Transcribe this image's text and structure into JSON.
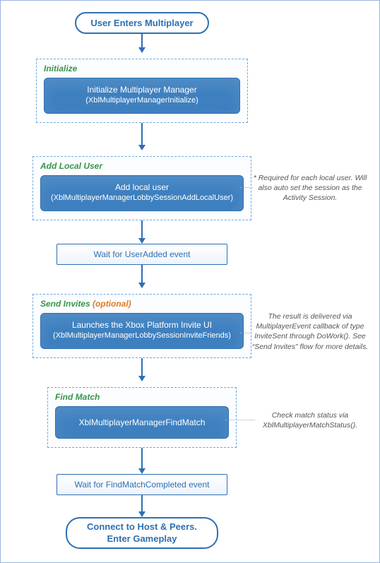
{
  "chart_data": {
    "type": "flowchart",
    "title": "",
    "nodes": [
      {
        "id": "start",
        "kind": "terminal",
        "label": "User Enters Multiplayer"
      },
      {
        "id": "init",
        "kind": "action",
        "group": "Initialize",
        "label": "Initialize Multiplayer Manager",
        "api": "(XblMultiplayerManagerInitialize)"
      },
      {
        "id": "addlocal",
        "kind": "action",
        "group": "Add Local User",
        "label": "Add local user",
        "api": "(XblMultiplayerManagerLobbySessionAddLocalUser)",
        "note": "* Required for each local user. Will also auto set the session as the Activity Session."
      },
      {
        "id": "wait1",
        "kind": "wait",
        "label": "Wait for UserAdded event"
      },
      {
        "id": "invite",
        "kind": "action",
        "group": "Send Invites",
        "group_suffix": "(optional)",
        "label": "Launches the Xbox Platform Invite UI",
        "api": "(XblMultiplayerManagerLobbySessionInviteFriends)",
        "note": "The result is delivered via MultiplayerEvent callback of type InviteSent through DoWork(). See \"Send Invites\" flow  for more details."
      },
      {
        "id": "find",
        "kind": "action",
        "group": "Find Match",
        "label": "XblMultiplayerManagerFindMatch",
        "api": "",
        "note": "Check match status via XblMultiplayerMatchStatus()."
      },
      {
        "id": "wait2",
        "kind": "wait",
        "label": "Wait for FindMatchCompleted event"
      },
      {
        "id": "end",
        "kind": "terminal",
        "label_line1": "Connect to Host & Peers.",
        "label_line2": "Enter Gameplay"
      }
    ],
    "edges": [
      [
        "start",
        "init"
      ],
      [
        "init",
        "addlocal"
      ],
      [
        "addlocal",
        "wait1"
      ],
      [
        "wait1",
        "invite"
      ],
      [
        "invite",
        "find"
      ],
      [
        "find",
        "wait2"
      ],
      [
        "wait2",
        "end"
      ]
    ]
  },
  "start": {
    "label": "User Enters Multiplayer"
  },
  "groups": {
    "initialize": {
      "title": "Initialize"
    },
    "add_local": {
      "title": "Add Local User"
    },
    "send_invites": {
      "title": "Send Invites",
      "suffix": "(optional)"
    },
    "find_match": {
      "title": "Find Match"
    }
  },
  "actions": {
    "initialize": {
      "line1": "Initialize Multiplayer Manager",
      "line2": "(XblMultiplayerManagerInitialize)"
    },
    "add_local": {
      "line1": "Add local user",
      "line2": "(XblMultiplayerManagerLobbySessionAddLocalUser)"
    },
    "invite": {
      "line1": "Launches the Xbox Platform Invite UI",
      "line2": "(XblMultiplayerManagerLobbySessionInviteFriends)"
    },
    "find": {
      "line1": "XblMultiplayerManagerFindMatch"
    }
  },
  "waits": {
    "user_added": "Wait for UserAdded event",
    "find_done": "Wait for FindMatchCompleted event"
  },
  "end": {
    "line1": "Connect to Host & Peers.",
    "line2": "Enter Gameplay"
  },
  "notes": {
    "add_local": "* Required for each local user. Will also auto set the session as the Activity Session.",
    "invite": "The result is delivered via MultiplayerEvent callback of type InviteSent through DoWork(). See “Send Invites” flow  for more details.",
    "find": "Check match status via XblMultiplayerMatchStatus()."
  }
}
